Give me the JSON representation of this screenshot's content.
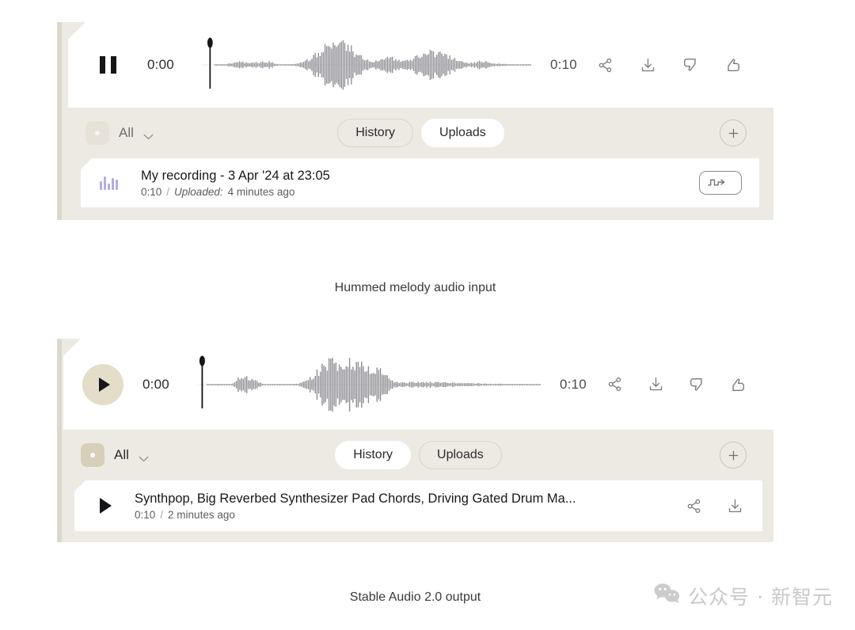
{
  "panels": [
    {
      "id": "input-panel",
      "player": {
        "transport_icon": "pause-icon",
        "current_time": "0:00",
        "total_time": "0:10",
        "actions": [
          {
            "name": "share-icon",
            "label": "Share"
          },
          {
            "name": "download-icon",
            "label": "Download"
          },
          {
            "name": "thumbs-down-icon",
            "label": "Dislike"
          },
          {
            "name": "thumbs-up-icon",
            "label": "Like"
          }
        ]
      },
      "toolbar": {
        "filter_label": "All",
        "filter_icon": "square-dot-icon",
        "chevron_icon": "chevron-down-icon",
        "tabs": [
          {
            "label": "History",
            "active": false
          },
          {
            "label": "Uploads",
            "active": true
          }
        ],
        "add_label": "+",
        "add_icon": "plus-icon"
      },
      "list": [
        {
          "lead_icon": "waveform-icon",
          "title": "My recording - 3 Apr '24 at 23:05",
          "duration": "0:10",
          "separator": "/",
          "meta_prefix": "Uploaded:",
          "meta_time": "4 minutes ago",
          "action_icon": "audio-to-audio-icon"
        }
      ],
      "caption": "Hummed melody audio input"
    },
    {
      "id": "output-panel",
      "player": {
        "transport_icon": "play-icon",
        "current_time": "0:00",
        "total_time": "0:10",
        "actions": [
          {
            "name": "share-icon",
            "label": "Share"
          },
          {
            "name": "download-icon",
            "label": "Download"
          },
          {
            "name": "thumbs-down-icon",
            "label": "Dislike"
          },
          {
            "name": "thumbs-up-icon",
            "label": "Like"
          }
        ]
      },
      "toolbar": {
        "filter_label": "All",
        "filter_icon": "square-dot-icon",
        "chevron_icon": "chevron-down-icon",
        "tabs": [
          {
            "label": "History",
            "active": true
          },
          {
            "label": "Uploads",
            "active": false
          }
        ],
        "add_label": "+",
        "add_icon": "plus-icon"
      },
      "list": [
        {
          "lead_icon": "play-icon",
          "title": "Synthpop, Big Reverbed Synthesizer Pad Chords, Driving Gated Drum Ma...",
          "duration": "0:10",
          "separator": "/",
          "meta_prefix": "",
          "meta_time": "2 minutes ago",
          "actions": [
            {
              "name": "share-icon",
              "label": "Share"
            },
            {
              "name": "download-icon",
              "label": "Download"
            }
          ]
        }
      ],
      "caption": "Stable Audio 2.0 output"
    }
  ],
  "watermark": {
    "icon": "wechat-icon",
    "text": "公众号 · 新智元"
  },
  "colors": {
    "panel_bg": "#edeae3",
    "card_bg": "#ffffff",
    "accent_beige": "#e3ddc9",
    "waveform": "#8d8d93",
    "lead_purple": "#b3aee0"
  }
}
